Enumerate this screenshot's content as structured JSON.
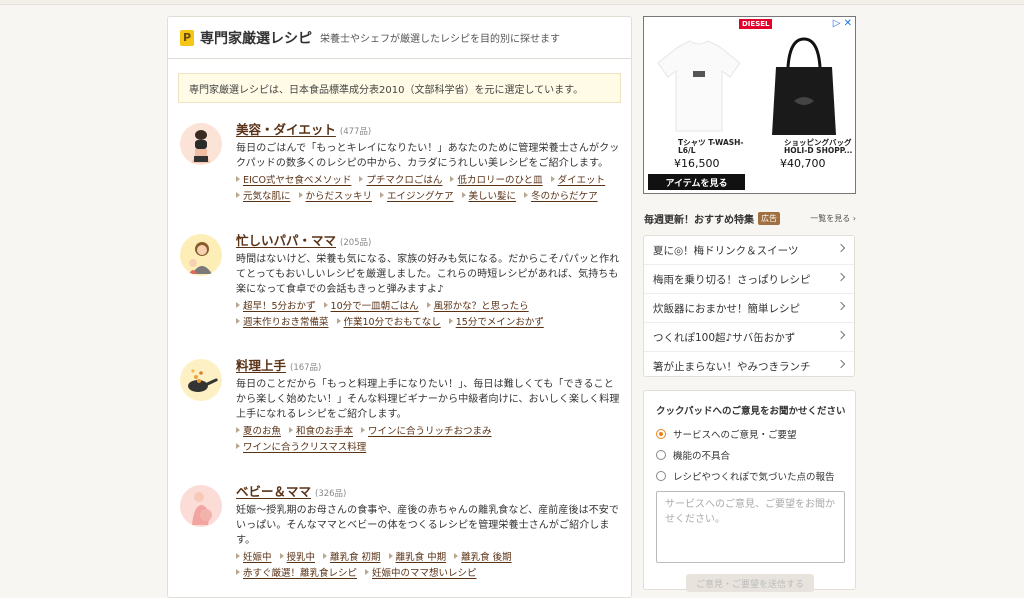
{
  "header": {
    "badge": "P",
    "title": "専門家厳選レシピ",
    "subtitle": "栄養士やシェフが厳選したレシピを目的別に探せます"
  },
  "notice": "専門家厳選レシピは、日本食品標準成分表2010（文部科学省）を元に選定しています。",
  "categories": [
    {
      "title": "美容・ダイエット",
      "count": "(477品)",
      "desc": "毎日のごはんで「もっとキレイになりたい！」あなたのために管理栄養士さんがクックパッドの数多くのレシピの中から、カラダにうれしい美レシピをご紹介します。",
      "links": [
        "EICO式ヤセ食べメソッド",
        "プチマクロごはん",
        "低カロリーのひと皿",
        "ダイエット",
        "元気な肌に",
        "からだスッキリ",
        "エイジングケア",
        "美しい髪に",
        "冬のからだケア"
      ]
    },
    {
      "title": "忙しいパパ・ママ",
      "count": "(205品)",
      "desc": "時間はないけど、栄養も気になる、家族の好みも気になる。だからこそパパッと作れてとってもおいしいレシピを厳選しました。これらの時短レシピがあれば、気持ちも楽になって食卓での会話もきっと弾みますよ♪",
      "links": [
        "超早！5分おかず",
        "10分で一皿朝ごはん",
        "風邪かな？と思ったら",
        "週末作りおき常備菜",
        "作業10分でおもてなし",
        "15分でメインおかず"
      ]
    },
    {
      "title": "料理上手",
      "count": "(167品)",
      "desc": "毎日のことだから「もっと料理上手になりたい！」、毎日は難しくても「できることから楽しく始めたい！」そんな料理ビギナーから中級者向けに、おいしく楽しく料理上手になれるレシピをご紹介します。",
      "links": [
        "夏のお魚",
        "和食のお手本",
        "ワインに合うリッチおつまみ",
        "ワインに合うクリスマス料理"
      ]
    },
    {
      "title": "ベビー＆ママ",
      "count": "(326品)",
      "desc": "妊娠〜授乳期のお母さんの食事や、産後の赤ちゃんの離乳食など、産前産後は不安でいっぱい。そんなママとベビーの体をつくるレシピを管理栄養士さんがご紹介します。",
      "links": [
        "妊娠中",
        "授乳中",
        "離乳食 初期",
        "離乳食 中期",
        "離乳食 後期",
        "赤すぐ厳選！離乳食レシピ",
        "妊娠中のママ想いレシピ"
      ]
    }
  ],
  "ad": {
    "brand": "DIESEL",
    "controls": "▷ ✕",
    "product1_name": "Tシャツ T-WASH-L6/L",
    "product1_price": "¥16,500",
    "product2_name": "ショッピングバッグ HOLI-D SHOPP...",
    "product2_price": "¥40,700",
    "cta": "アイテムを見る"
  },
  "featured": {
    "title": "毎週更新！おすすめ特集",
    "tag": "広告",
    "more": "一覧を見る ›",
    "items": [
      "夏に◎！梅ドリンク＆スイーツ",
      "梅雨を乗り切る！さっぱりレシピ",
      "炊飯器におまかせ！簡単レシピ",
      "つくれぽ100超♪サバ缶おかず",
      "箸が止まらない！やみつきランチ"
    ]
  },
  "feedback": {
    "title": "クックパッドへのご意見をお聞かせください",
    "options": [
      "サービスへのご意見・ご要望",
      "機能の不具合",
      "レシピやつくれぽで気づいた点の報告"
    ],
    "selected": 0,
    "placeholder": "サービスへのご意見、ご要望をお聞かせください。",
    "submit": "ご意見・ご要望を送信する"
  },
  "colors": {
    "accent_brown": "#5a3317",
    "radio_orange": "#e6851e",
    "tag_brown": "#a07040",
    "notice_bg": "#fffbe6"
  }
}
